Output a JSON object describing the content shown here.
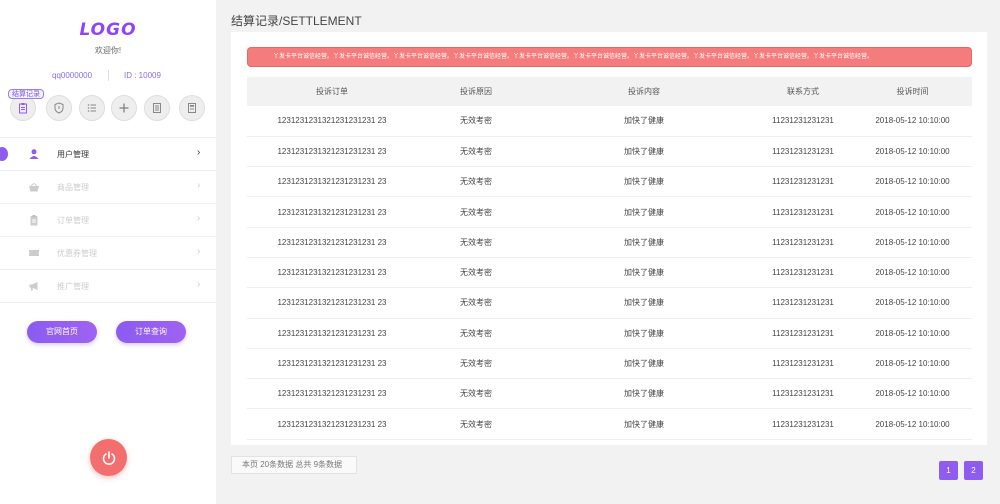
{
  "sidebar": {
    "logo": "LOGO",
    "welcome": "欢迎你!",
    "account": "qq0000000",
    "id_label": "ID : 10009",
    "badge": "结算记录",
    "icons": [
      "clipboard-icon",
      "shield-icon",
      "list-icon",
      "plus-icon",
      "document-icon",
      "calculator-icon"
    ],
    "menu": [
      {
        "label": "用户管理",
        "icon": "user-icon",
        "active": true
      },
      {
        "label": "商品管理",
        "icon": "basket-icon",
        "active": false
      },
      {
        "label": "订单管理",
        "icon": "clipboard-icon",
        "active": false
      },
      {
        "label": "优惠券管理",
        "icon": "ticket-icon",
        "active": false
      },
      {
        "label": "推广管理",
        "icon": "megaphone-icon",
        "active": false
      }
    ],
    "home_button": "官网首页",
    "order_button": "订单查询"
  },
  "main": {
    "title": "结算记录/SETTLEMENT",
    "notice": "丫发卡平台诚信经营。丫发卡平台诚信经营。丫发卡平台诚信经营。丫发卡平台诚信经营。丫发卡平台诚信经营。丫发卡平台诚信经营。丫发卡平台诚信经营。丫发卡平台诚信经营。丫发卡平台诚信经营。丫发卡平台诚信经营。",
    "columns": [
      "投诉订单",
      "投诉原因",
      "投诉内容",
      "联系方式",
      "投诉时间"
    ],
    "rows": [
      [
        "1231231231321231231231 23",
        "无效考密",
        "加快了健康",
        "11231231231231",
        "2018-05-12   10:10:00"
      ],
      [
        "1231231231321231231231 23",
        "无效考密",
        "加快了健康",
        "11231231231231",
        "2018-05-12   10:10:00"
      ],
      [
        "1231231231321231231231 23",
        "无效考密",
        "加快了健康",
        "11231231231231",
        "2018-05-12   10:10:00"
      ],
      [
        "1231231231321231231231 23",
        "无效考密",
        "加快了健康",
        "11231231231231",
        "2018-05-12   10:10:00"
      ],
      [
        "1231231231321231231231 23",
        "无效考密",
        "加快了健康",
        "11231231231231",
        "2018-05-12   10:10:00"
      ],
      [
        "1231231231321231231231 23",
        "无效考密",
        "加快了健康",
        "11231231231231",
        "2018-05-12   10:10:00"
      ],
      [
        "1231231231321231231231 23",
        "无效考密",
        "加快了健康",
        "11231231231231",
        "2018-05-12   10:10:00"
      ],
      [
        "1231231231321231231231 23",
        "无效考密",
        "加快了健康",
        "11231231231231",
        "2018-05-12   10:10:00"
      ],
      [
        "1231231231321231231231 23",
        "无效考密",
        "加快了健康",
        "11231231231231",
        "2018-05-12   10:10:00"
      ],
      [
        "1231231231321231231231 23",
        "无效考密",
        "加快了健康",
        "11231231231231",
        "2018-05-12   10:10:00"
      ],
      [
        "1231231231321231231231 23",
        "无效考密",
        "加快了健康",
        "11231231231231",
        "2018-05-12   10:10:00"
      ]
    ],
    "summary": "本页   20条数据  总共   9条数据",
    "pages": [
      "1",
      "2"
    ]
  },
  "colors": {
    "accent": "#8e5cf0",
    "notice": "#f47c7c",
    "power": "#f36e6e"
  }
}
